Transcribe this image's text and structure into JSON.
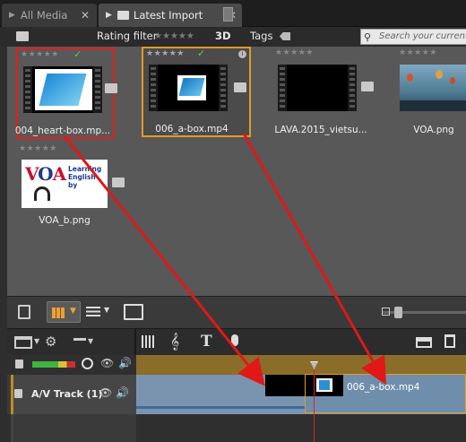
{
  "tabs": [
    {
      "label": "All Media"
    },
    {
      "label": "Latest Import"
    }
  ],
  "filterbar": {
    "rating_filter_label": "Rating filter",
    "threed_label": "3D",
    "tags_label": "Tags",
    "search_placeholder": "Search your current"
  },
  "library": {
    "items": [
      {
        "filename": "004_heart-box.mp...",
        "selected": "red-border"
      },
      {
        "filename": "006_a-box.mp4",
        "selected": "orange-border"
      },
      {
        "filename": "LAVA.2015_vietsu..."
      },
      {
        "filename": "VOA.png"
      },
      {
        "filename": "VOA_b.png"
      }
    ],
    "voa_logo_text": "Learning English by"
  },
  "timeline": {
    "track_name": "A/V Track (1)",
    "clip_name": "006_a-box.mp4"
  },
  "colors": {
    "accent_orange": "#e39a2a",
    "selection_red": "#e02020",
    "arrow_red": "#e01818",
    "check_green": "#4fcf5c",
    "ruler_gold": "#8b6d2a",
    "track_blue": "#7a94b0"
  }
}
